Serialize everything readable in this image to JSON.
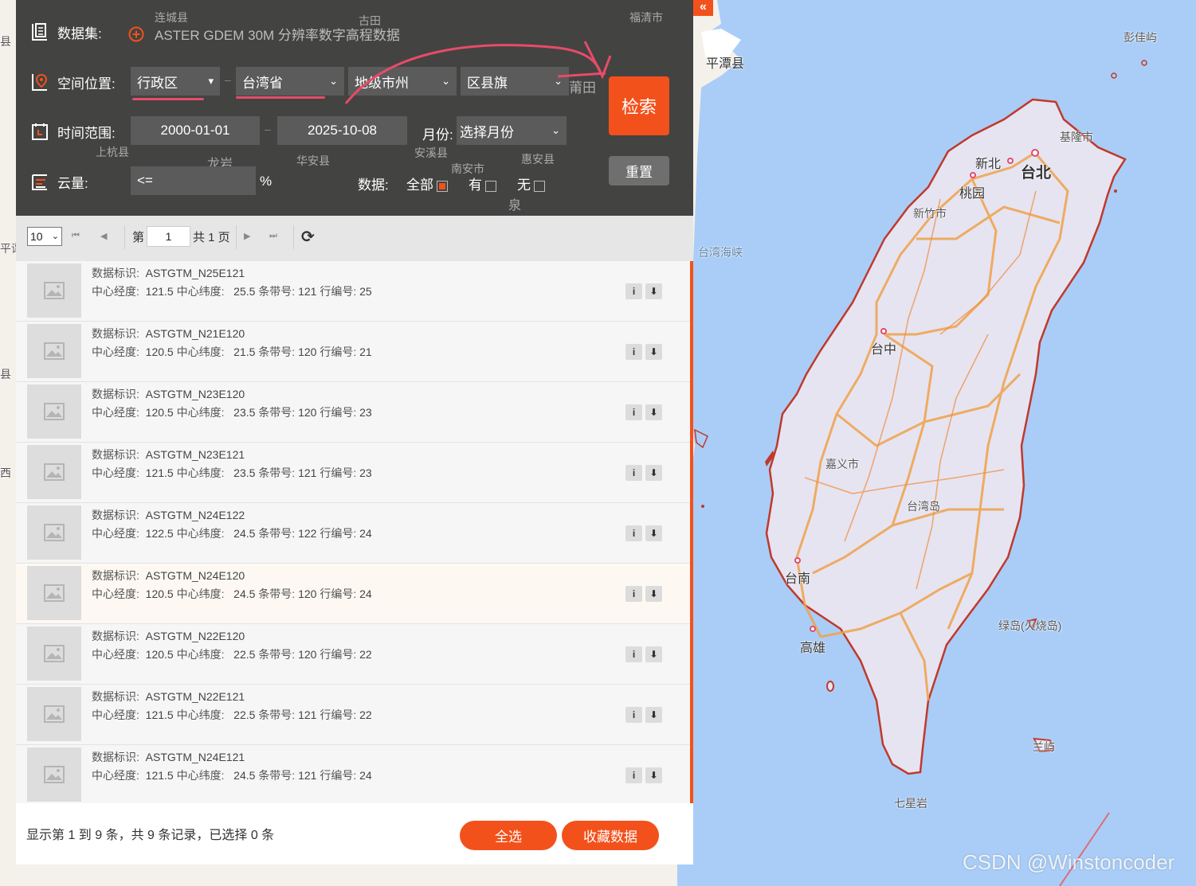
{
  "collapse_icon": "«",
  "search_panel": {
    "dataset": {
      "label": "数据集:",
      "icon": "dataset-icon",
      "value_icon": "add-circle-icon",
      "value": "ASTER GDEM 30M 分辨率数字高程数据"
    },
    "location": {
      "label": "空间位置:",
      "icon": "location-icon",
      "type": "行政区",
      "province": "台湾省",
      "city": "地级市州",
      "county": "区县旗",
      "type_arrow": "▾",
      "select_arrow": "⌄"
    },
    "time": {
      "label": "时间范围:",
      "icon": "calendar-icon",
      "start": "2000-01-01",
      "end": "2025-10-08",
      "month_label": "月份:",
      "month_value": "选择月份"
    },
    "cloud": {
      "label": "云量:",
      "icon": "cloud-icon",
      "op": "<=",
      "unit": "%",
      "data_label": "数据:",
      "opt_all": "全部",
      "opt_has": "有",
      "opt_none": "无"
    },
    "dash": "–",
    "search_btn": "检索",
    "reset_btn": "重置",
    "annotation_color": "#e84b68"
  },
  "pagination": {
    "page_size": "10",
    "page_prefix": "第",
    "page": "1",
    "page_suffix": "共 1 页",
    "first": "⏮",
    "prev": "◀",
    "next": "▶",
    "last": "⏭",
    "refresh": "⟳"
  },
  "field_labels": {
    "id": "数据标识:",
    "lon": "中心经度:",
    "lat": "中心纬度:",
    "band": "条带号:",
    "row": "行编号:"
  },
  "items": [
    {
      "id": "ASTGTM_N25E121",
      "lon": "121.5",
      "lat": "25.5",
      "band": "121",
      "row": "25"
    },
    {
      "id": "ASTGTM_N21E120",
      "lon": "120.5",
      "lat": "21.5",
      "band": "120",
      "row": "21"
    },
    {
      "id": "ASTGTM_N23E120",
      "lon": "120.5",
      "lat": "23.5",
      "band": "120",
      "row": "23"
    },
    {
      "id": "ASTGTM_N23E121",
      "lon": "121.5",
      "lat": "23.5",
      "band": "121",
      "row": "23"
    },
    {
      "id": "ASTGTM_N24E122",
      "lon": "122.5",
      "lat": "24.5",
      "band": "122",
      "row": "24"
    },
    {
      "id": "ASTGTM_N24E120",
      "lon": "120.5",
      "lat": "24.5",
      "band": "120",
      "row": "24"
    },
    {
      "id": "ASTGTM_N22E120",
      "lon": "120.5",
      "lat": "22.5",
      "band": "120",
      "row": "22"
    },
    {
      "id": "ASTGTM_N22E121",
      "lon": "121.5",
      "lat": "22.5",
      "band": "121",
      "row": "22"
    },
    {
      "id": "ASTGTM_N24E121",
      "lon": "121.5",
      "lat": "24.5",
      "band": "121",
      "row": "24"
    }
  ],
  "item_buttons": {
    "info": "i",
    "download": "⬇"
  },
  "footer": {
    "summary": "显示第 1 到 9 条，共 9 条记录，已选择 0 条",
    "select_all": "全选",
    "favorite": "收藏数据"
  },
  "map": {
    "labels": {
      "penghu": "彭佳屿",
      "pingtan": "平潭县",
      "keelung": "基隆市",
      "newtaipei": "新北",
      "taipei": "台北",
      "taoyuan": "桃园",
      "hsinchu": "新竹市",
      "strait": "台湾海峡",
      "taichung": "台中",
      "chiayi": "嘉义市",
      "island": "台湾岛",
      "tainan": "台南",
      "kaohsiung": "高雄",
      "greenisland": "绿岛(火烧岛)",
      "lanyu": "兰屿",
      "qixingyan": "七星岩",
      "putian": "莆田",
      "quan": "泉",
      "longyan": "龙岩",
      "lianchengxian": "连城县",
      "fuqing": "福清市",
      "gutian": "古田",
      "huaan": "华安县",
      "shanghang": "上杭县",
      "huian": "惠安县",
      "nanan": "南安市",
      "anxi": "安溪县",
      "left_edge_1": "县",
      "left_edge_2": "平谭",
      "left_edge_3": "西",
      "left_edge_4": "县"
    },
    "watermark": "CSDN @Winstoncoder"
  }
}
